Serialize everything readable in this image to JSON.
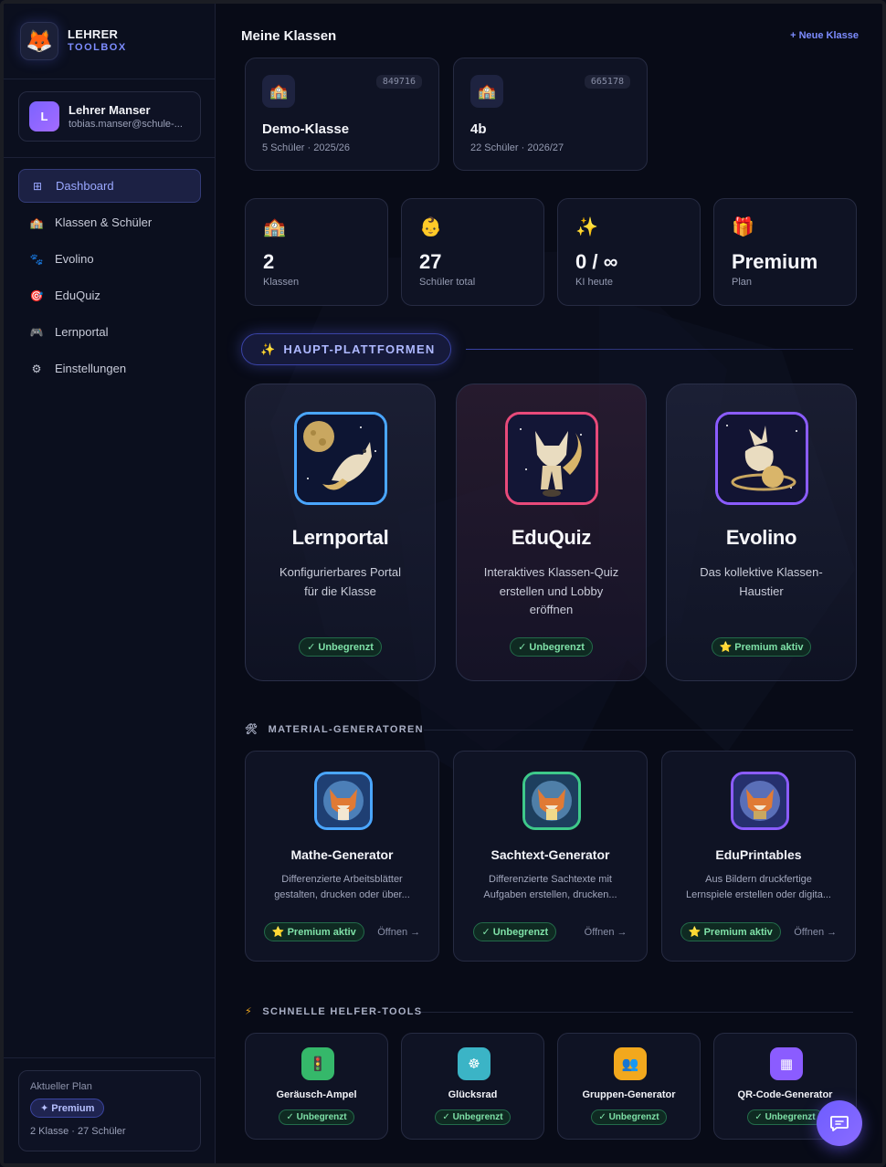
{
  "brand": {
    "line1": "LEHRER",
    "line2": "TOOLBOX",
    "logo_icon": "fox-icon"
  },
  "user": {
    "initial": "L",
    "name": "Lehrer Manser",
    "email": "tobias.manser@schule-..."
  },
  "nav": [
    {
      "label": "Dashboard",
      "icon": "⊞",
      "active": true
    },
    {
      "label": "Klassen & Schüler",
      "icon": "🏫"
    },
    {
      "label": "Evolino",
      "icon": "🐾"
    },
    {
      "label": "EduQuiz",
      "icon": "🎯"
    },
    {
      "label": "Lernportal",
      "icon": "🎮"
    },
    {
      "label": "Einstellungen",
      "icon": "⚙"
    }
  ],
  "plan": {
    "label": "Aktueller Plan",
    "name": "✦ Premium",
    "meta": "2 Klasse · 27 Schüler"
  },
  "header": {
    "title": "Meine Klassen",
    "new_class": "+ Neue Klasse"
  },
  "classes": [
    {
      "icon": "🏫",
      "code": "849716",
      "name": "Demo-Klasse",
      "meta": "5 Schüler · 2025/26"
    },
    {
      "icon": "🏫",
      "code": "665178",
      "name": "4b",
      "meta": "22 Schüler · 2026/27"
    }
  ],
  "stats": [
    {
      "icon": "🏫",
      "value": "2",
      "label": "Klassen"
    },
    {
      "icon": "👶",
      "value": "27",
      "label": "Schüler total"
    },
    {
      "icon": "✨",
      "value": "0 / ∞",
      "label": "KI heute"
    },
    {
      "icon": "🎁",
      "value": "Premium",
      "label": "Plan"
    }
  ],
  "platforms_heading": {
    "icon": "✨",
    "label": "HAUPT-PLATTFORMEN"
  },
  "platforms": [
    {
      "title": "Lernportal",
      "desc": "Konfigurierbares Portal für die Klasse",
      "badge": "✓ Unbegrenzt",
      "color": "#4aa6ff"
    },
    {
      "title": "EduQuiz",
      "desc": "Interaktives Klassen-Quiz erstellen und Lobby eröffnen",
      "badge": "✓ Unbegrenzt",
      "color": "#e84a7a"
    },
    {
      "title": "Evolino",
      "desc": "Das kollektive Klassen-Haustier",
      "badge": "⭐ Premium aktiv",
      "color": "#8b5cff"
    }
  ],
  "generators_heading": {
    "icon": "🛠",
    "label": "MATERIAL-GENERATOREN"
  },
  "generators": [
    {
      "title": "Mathe-Generator",
      "desc": "Differenzierte Arbeitsblätter gestalten, drucken oder über...",
      "badge": "⭐ Premium aktiv",
      "open": "Öffnen →",
      "color": "#4aa6ff"
    },
    {
      "title": "Sachtext-Generator",
      "desc": "Differenzierte Sachtexte mit Aufgaben erstellen, drucken...",
      "badge": "✓ Unbegrenzt",
      "open": "Öffnen →",
      "color": "#3ec98a"
    },
    {
      "title": "EduPrintables",
      "desc": "Aus Bildern druckfertige Lernspiele erstellen oder digita...",
      "badge": "⭐ Premium aktiv",
      "open": "Öffnen →",
      "color": "#8b5cff"
    }
  ],
  "tools_heading": {
    "icon": "⚡",
    "label": "SCHNELLE HELFER-TOOLS"
  },
  "tools": [
    {
      "title": "Geräusch-Ampel",
      "badge": "✓ Unbegrenzt",
      "icon": "🚦",
      "color": "#35b86a"
    },
    {
      "title": "Glücksrad",
      "badge": "✓ Unbegrenzt",
      "icon": "☸",
      "color": "#3bb4c6"
    },
    {
      "title": "Gruppen-Generator",
      "badge": "✓ Unbegrenzt",
      "icon": "👥",
      "color": "#f2a81d"
    },
    {
      "title": "QR-Code-Generator",
      "badge": "✓ Unbegrenzt",
      "icon": "▦",
      "color": "#8b5cff"
    }
  ]
}
